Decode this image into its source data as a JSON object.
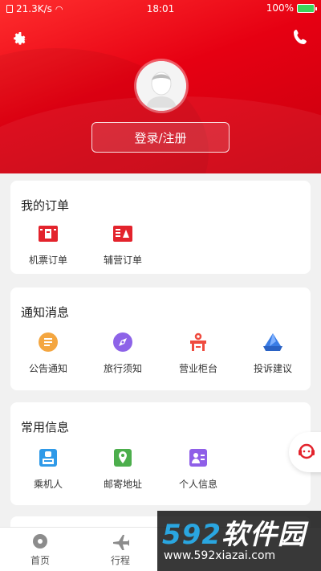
{
  "status": {
    "speed": "21.3K/s",
    "time": "18:01",
    "battery": "100%"
  },
  "header": {
    "login_label": "登录/注册"
  },
  "orders": {
    "title": "我的订单",
    "items": [
      {
        "label": "机票订单",
        "icon": "ticket-icon"
      },
      {
        "label": "辅营订单",
        "icon": "service-order-icon"
      }
    ]
  },
  "notices": {
    "title": "通知消息",
    "items": [
      {
        "label": "公告通知",
        "icon": "announcement-icon"
      },
      {
        "label": "旅行须知",
        "icon": "compass-icon"
      },
      {
        "label": "营业柜台",
        "icon": "counter-icon"
      },
      {
        "label": "投诉建议",
        "icon": "feedback-icon"
      }
    ]
  },
  "info": {
    "title": "常用信息",
    "items": [
      {
        "label": "乘机人",
        "icon": "passenger-icon"
      },
      {
        "label": "邮寄地址",
        "icon": "location-icon"
      },
      {
        "label": "个人信息",
        "icon": "profile-icon"
      }
    ]
  },
  "tabs": [
    {
      "label": "首页"
    },
    {
      "label": "行程"
    }
  ],
  "watermark": {
    "brand_a": "592",
    "brand_b": "软件园",
    "url": "www.592xiazai.com"
  },
  "colors": {
    "brand_red": "#e60012"
  }
}
